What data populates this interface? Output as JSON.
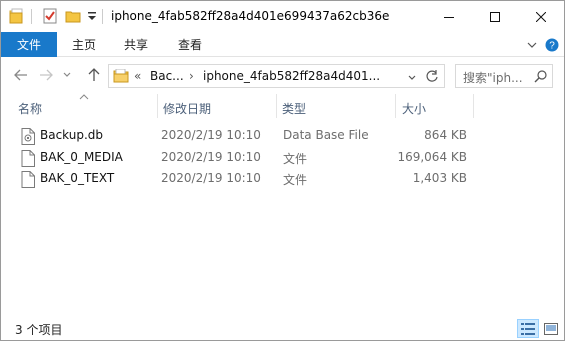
{
  "window": {
    "title": "iphone_4fab582ff28a4d401e699437a62cb36e"
  },
  "ribbon": {
    "tabs": [
      {
        "label": "文件",
        "active": true
      },
      {
        "label": "主页"
      },
      {
        "label": "共享"
      },
      {
        "label": "查看"
      }
    ]
  },
  "navigation": {
    "address_overflow": "«",
    "address_segments": [
      "Bac...",
      "iphone_4fab582ff28a4d401..."
    ],
    "search_placeholder": "搜索\"iph..."
  },
  "columns": {
    "name": "名称",
    "date": "修改日期",
    "type": "类型",
    "size": "大小"
  },
  "files": [
    {
      "name": "Backup.db",
      "date": "2020/2/19 10:10",
      "type": "Data Base File",
      "size": "864 KB",
      "icon": "database-file-icon"
    },
    {
      "name": "BAK_0_MEDIA",
      "date": "2020/2/19 10:10",
      "type": "文件",
      "size": "169,064 KB",
      "icon": "file-icon"
    },
    {
      "name": "BAK_0_TEXT",
      "date": "2020/2/19 10:10",
      "type": "文件",
      "size": "1,403 KB",
      "icon": "file-icon"
    }
  ],
  "status": {
    "item_count": "3 个项目"
  },
  "colors": {
    "file_tab_bg": "#1979ca",
    "header_text": "#4c607a",
    "muted_text": "#6d6d6d",
    "view_active": "#cce8ff"
  }
}
